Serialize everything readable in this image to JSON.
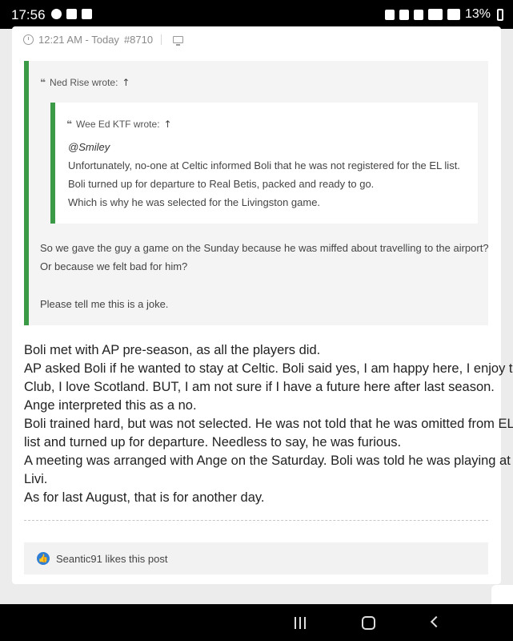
{
  "status_bar": {
    "time": "17:56",
    "battery": "13%"
  },
  "post": {
    "timestamp": "12:21 AM - Today",
    "post_number": "#8710",
    "outer_quote": {
      "author_line": "Ned Rise wrote:",
      "inner_quote": {
        "author_line": "Wee Ed KTF wrote:",
        "mention": "@Smiley",
        "lines": [
          "Unfortunately, no-one at Celtic informed Boli that he was not registered for the EL list.",
          "Boli turned up for departure to Real Betis, packed and ready to go.",
          "Which is why he was selected for the Livingston game."
        ]
      },
      "lines": [
        "So we gave the guy a game on the Sunday because he was miffed about travelling to the airport?",
        "Or because we felt bad for him?",
        "Please tell me this is a joke."
      ]
    },
    "body_lines": [
      "Boli met with AP pre-season, as all the players did.",
      "AP asked Boli if he wanted to stay at Celtic. Boli said yes, I am happy here, I enjoy the",
      "Club, I love Scotland. BUT, I am not sure if I have a future here after last season.",
      "Ange interpreted this as a no.",
      "Boli trained hard, but was not selected. He was not told that he was omitted from EL",
      "list and turned up for departure. Needless to say, he was furious.",
      "A meeting was arranged with Ange on the Saturday. Boli was told he was playing at",
      "Livi.",
      "As for last August, that is for another day."
    ],
    "likes_text": "Seantic91 likes this post"
  },
  "colors": {
    "quote_bar": "#3a9a46",
    "like_blue": "#2f7fd6"
  }
}
